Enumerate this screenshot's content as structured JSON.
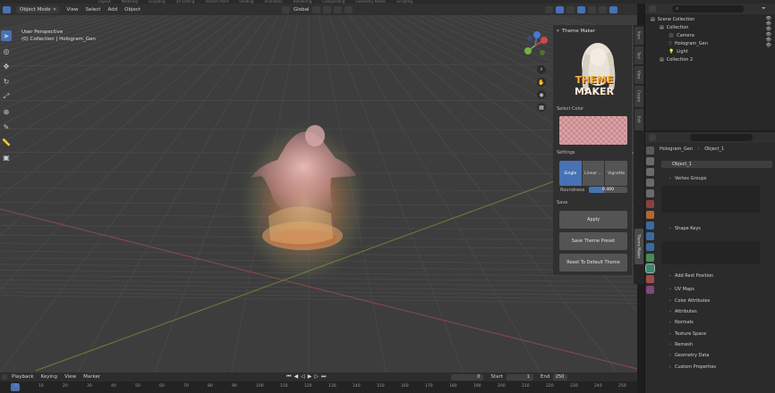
{
  "top_tabs": [
    "Layout",
    "Modeling",
    "Sculpting",
    "UV Editing",
    "Texture Paint",
    "Shading",
    "Animation",
    "Rendering",
    "Compositing",
    "Geometry Nodes",
    "Scripting"
  ],
  "header": {
    "mode": "Object Mode",
    "menus": [
      "View",
      "Select",
      "Add",
      "Object"
    ],
    "transform_orientation": "Global",
    "options_label": "Options"
  },
  "viewport": {
    "perspective": "User Perspective",
    "collection_path": "(0) Collection | Hologram_Gen"
  },
  "theme_maker": {
    "panel_title": "Theme Maker",
    "logo_text_top": "THEME",
    "logo_text_bottom": "MAKER",
    "select_color_label": "Select Color",
    "settings_label": "Settings",
    "modes": [
      "Single",
      "Linear ...",
      "Vignette"
    ],
    "active_mode": "Single",
    "roundness_label": "Roundness",
    "roundness_value": "0.400",
    "roundness_fraction": 0.4,
    "save_label": "Save",
    "apply_label": "Apply",
    "save_preset_label": "Save Theme Preset",
    "reset_label": "Reset To Default Theme"
  },
  "side_tabs": [
    "Item",
    "Tool",
    "View",
    "Create",
    "Edit",
    "Theme Maker"
  ],
  "outliner": {
    "search_placeholder": "",
    "rows": [
      {
        "label": "Scene Collection",
        "indent": 0
      },
      {
        "label": "Collection",
        "indent": 1
      },
      {
        "label": "Camera",
        "indent": 2
      },
      {
        "label": "Hologram_Gen",
        "indent": 2
      },
      {
        "label": "Light",
        "indent": 2
      },
      {
        "label": "Collection 2",
        "indent": 1
      }
    ]
  },
  "properties": {
    "breadcrumb_object": "Hologram_Gen",
    "breadcrumb_data": "Object_1",
    "data_name": "Object_1",
    "sections": [
      "Vertex Groups",
      "Shape Keys",
      "Add Rest Position",
      "UV Maps",
      "Color Attributes",
      "Attributes",
      "Normals",
      "Texture Space",
      "Remesh",
      "Geometry Data",
      "Custom Properties"
    ]
  },
  "timeline": {
    "menus": [
      "Playback",
      "Keying",
      "View",
      "Marker"
    ],
    "current_frame": "0",
    "start_label": "Start",
    "start_value": "1",
    "end_label": "End",
    "end_value": "250",
    "ticks": [
      "0",
      "10",
      "20",
      "30",
      "40",
      "50",
      "60",
      "70",
      "80",
      "90",
      "100",
      "110",
      "120",
      "130",
      "140",
      "150",
      "160",
      "170",
      "180",
      "190",
      "200",
      "210",
      "220",
      "230",
      "240",
      "250"
    ]
  },
  "colors": {
    "accent": "#4772b3",
    "swatch": "#c98a8f",
    "hologram": "#e3a062"
  }
}
